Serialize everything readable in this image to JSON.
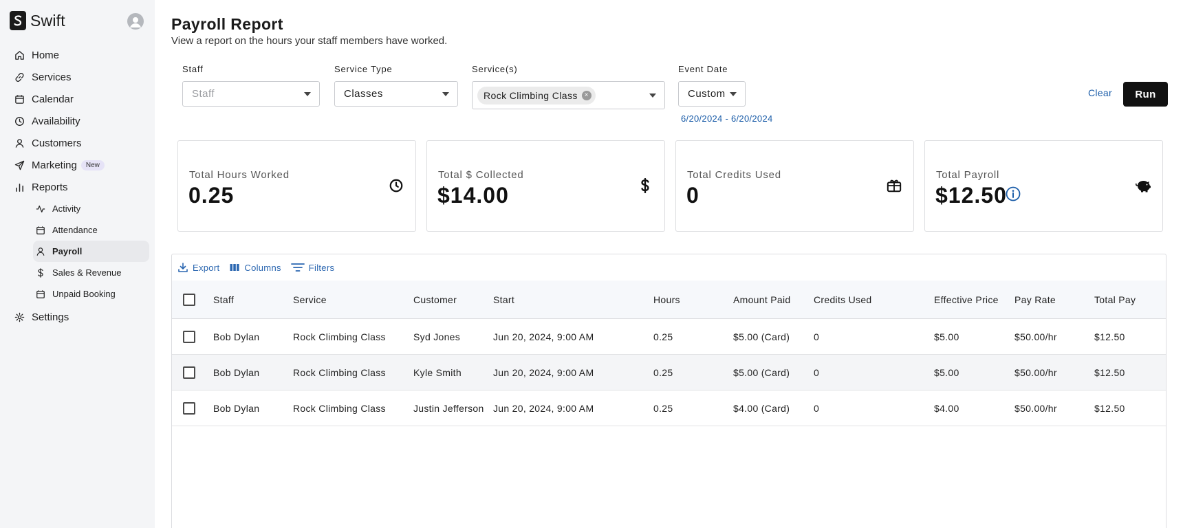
{
  "app": {
    "brand_name": "Swift",
    "accent_color": "#1a5ca8"
  },
  "sidebar": {
    "items": [
      {
        "label": "Home",
        "icon": "home-icon"
      },
      {
        "label": "Services",
        "icon": "link-icon"
      },
      {
        "label": "Calendar",
        "icon": "calendar-icon"
      },
      {
        "label": "Availability",
        "icon": "clock-icon"
      },
      {
        "label": "Customers",
        "icon": "user-icon"
      },
      {
        "label": "Marketing",
        "icon": "send-icon",
        "badge": "New"
      },
      {
        "label": "Reports",
        "icon": "bar-chart-icon"
      }
    ],
    "report_subitems": [
      {
        "label": "Activity",
        "icon": "activity-icon"
      },
      {
        "label": "Attendance",
        "icon": "calendar-check-icon"
      },
      {
        "label": "Payroll",
        "icon": "user-icon",
        "active": true
      },
      {
        "label": "Sales & Revenue",
        "icon": "dollar-icon"
      },
      {
        "label": "Unpaid Booking",
        "icon": "calendar-icon"
      }
    ],
    "settings_label": "Settings"
  },
  "header": {
    "title": "Payroll Report",
    "subtitle": "View a report on the hours your staff members have worked."
  },
  "filters": {
    "staff": {
      "label": "Staff",
      "placeholder": "Staff"
    },
    "service_type": {
      "label": "Service Type",
      "value": "Classes"
    },
    "services": {
      "label": "Service(s)",
      "chips": [
        "Rock Climbing Class"
      ]
    },
    "event_date": {
      "label": "Event Date",
      "value": "Custom",
      "range": "6/20/2024 - 6/20/2024"
    },
    "clear_label": "Clear",
    "run_label": "Run"
  },
  "summary": [
    {
      "label": "Total Hours Worked",
      "value": "0.25",
      "icon": "clock-icon"
    },
    {
      "label": "Total $ Collected",
      "value": "$14.00",
      "icon": "dollar-icon"
    },
    {
      "label": "Total Credits Used",
      "value": "0",
      "icon": "gift-card-icon"
    },
    {
      "label": "Total Payroll",
      "value": "$12.50",
      "icon": "piggy-bank-icon",
      "info": true
    }
  ],
  "table": {
    "toolbar": {
      "export": "Export",
      "columns": "Columns",
      "filters": "Filters"
    },
    "columns": [
      "Staff",
      "Service",
      "Customer",
      "Start",
      "Hours",
      "Amount Paid",
      "Credits Used",
      "Effective Price",
      "Pay Rate",
      "Total Pay"
    ],
    "rows": [
      [
        "Bob Dylan",
        "Rock Climbing Class",
        "Syd Jones",
        "Jun 20, 2024, 9:00 AM",
        "0.25",
        "$5.00 (Card)",
        "0",
        "$5.00",
        "$50.00/hr",
        "$12.50"
      ],
      [
        "Bob Dylan",
        "Rock Climbing Class",
        "Kyle Smith",
        "Jun 20, 2024, 9:00 AM",
        "0.25",
        "$5.00 (Card)",
        "0",
        "$5.00",
        "$50.00/hr",
        "$12.50"
      ],
      [
        "Bob Dylan",
        "Rock Climbing Class",
        "Justin Jefferson",
        "Jun 20, 2024, 9:00 AM",
        "0.25",
        "$4.00 (Card)",
        "0",
        "$4.00",
        "$50.00/hr",
        "$12.50"
      ]
    ]
  }
}
